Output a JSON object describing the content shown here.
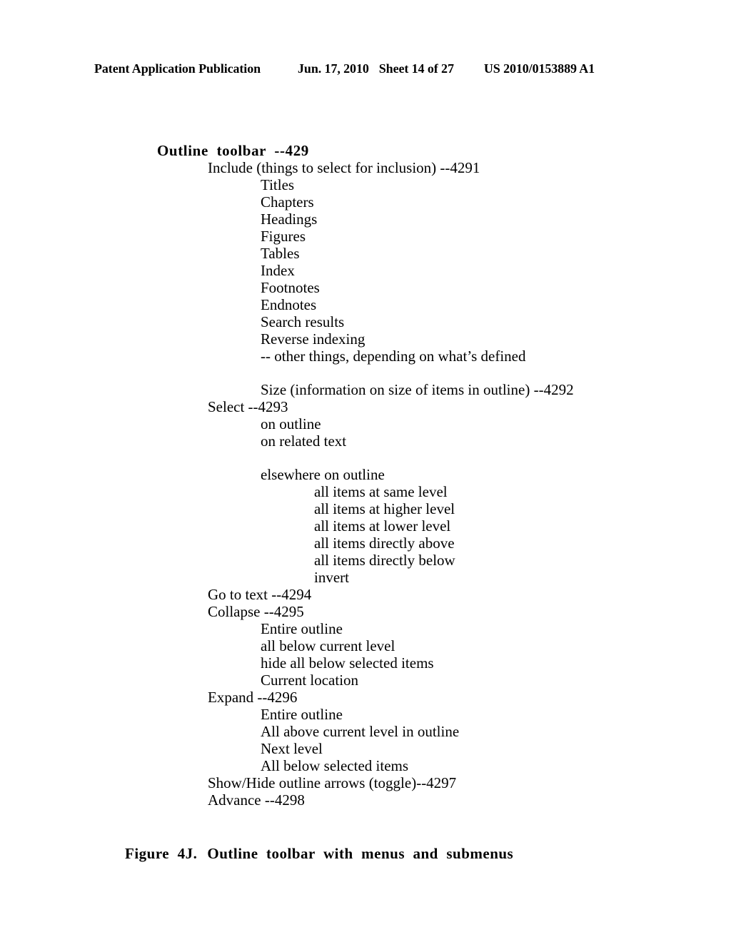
{
  "header": {
    "publication": "Patent Application Publication",
    "date": "Jun. 17, 2010",
    "sheet": "Sheet 14 of 27",
    "publication_number": "US 2010/0153889 A1"
  },
  "outline": {
    "title": "Outline  toolbar  --429",
    "lines": [
      {
        "level": 0,
        "text": "Outline  toolbar  --429",
        "spacer_before": false
      },
      {
        "level": 1,
        "text": "Include (things to select for inclusion) --4291",
        "spacer_before": false
      },
      {
        "level": 2,
        "text": "Titles",
        "spacer_before": false
      },
      {
        "level": 2,
        "text": "Chapters",
        "spacer_before": false
      },
      {
        "level": 2,
        "text": "Headings",
        "spacer_before": false
      },
      {
        "level": 2,
        "text": "Figures",
        "spacer_before": false
      },
      {
        "level": 2,
        "text": "Tables",
        "spacer_before": false
      },
      {
        "level": 2,
        "text": "Index",
        "spacer_before": false
      },
      {
        "level": 2,
        "text": "Footnotes",
        "spacer_before": false
      },
      {
        "level": 2,
        "text": "Endnotes",
        "spacer_before": false
      },
      {
        "level": 2,
        "text": "Search results",
        "spacer_before": false
      },
      {
        "level": 2,
        "text": "Reverse indexing",
        "spacer_before": false
      },
      {
        "level": 2,
        "text": "-- other things, depending on what’s defined",
        "spacer_before": false
      },
      {
        "level": 2,
        "text": "Size (information on size of items in outline) --4292",
        "spacer_before": true
      },
      {
        "level": 1,
        "text": "Select --4293",
        "spacer_before": false
      },
      {
        "level": 2,
        "text": "on outline",
        "spacer_before": false
      },
      {
        "level": 2,
        "text": "on related text",
        "spacer_before": false
      },
      {
        "level": 2,
        "text": "elsewhere on outline",
        "spacer_before": true
      },
      {
        "level": 3,
        "text": "all items at same level",
        "spacer_before": false
      },
      {
        "level": 3,
        "text": "all items at higher level",
        "spacer_before": false
      },
      {
        "level": 3,
        "text": "all items at lower level",
        "spacer_before": false
      },
      {
        "level": 3,
        "text": "all items directly above",
        "spacer_before": false
      },
      {
        "level": 3,
        "text": "all items directly below",
        "spacer_before": false
      },
      {
        "level": 3,
        "text": "invert",
        "spacer_before": false
      },
      {
        "level": 1,
        "text": "Go to text --4294",
        "spacer_before": false
      },
      {
        "level": 1,
        "text": "Collapse --4295",
        "spacer_before": false
      },
      {
        "level": 2,
        "text": "Entire outline",
        "spacer_before": false
      },
      {
        "level": 2,
        "text": "all below current level",
        "spacer_before": false
      },
      {
        "level": 2,
        "text": "hide all below selected items",
        "spacer_before": false
      },
      {
        "level": 2,
        "text": "Current location",
        "spacer_before": false
      },
      {
        "level": 1,
        "text": "Expand --4296",
        "spacer_before": false
      },
      {
        "level": 2,
        "text": "Entire outline",
        "spacer_before": false
      },
      {
        "level": 2,
        "text": "All above current level in outline",
        "spacer_before": false
      },
      {
        "level": 2,
        "text": "Next level",
        "spacer_before": false
      },
      {
        "level": 2,
        "text": "All below selected items",
        "spacer_before": false
      },
      {
        "level": 1,
        "text": "Show/Hide outline arrows (toggle)--4297",
        "spacer_before": false
      },
      {
        "level": 1,
        "text": "Advance --4298",
        "spacer_before": false
      }
    ]
  },
  "figure": {
    "label": "Figure  4J.",
    "caption": "Outline  toolbar  with  menus  and  submenus"
  }
}
